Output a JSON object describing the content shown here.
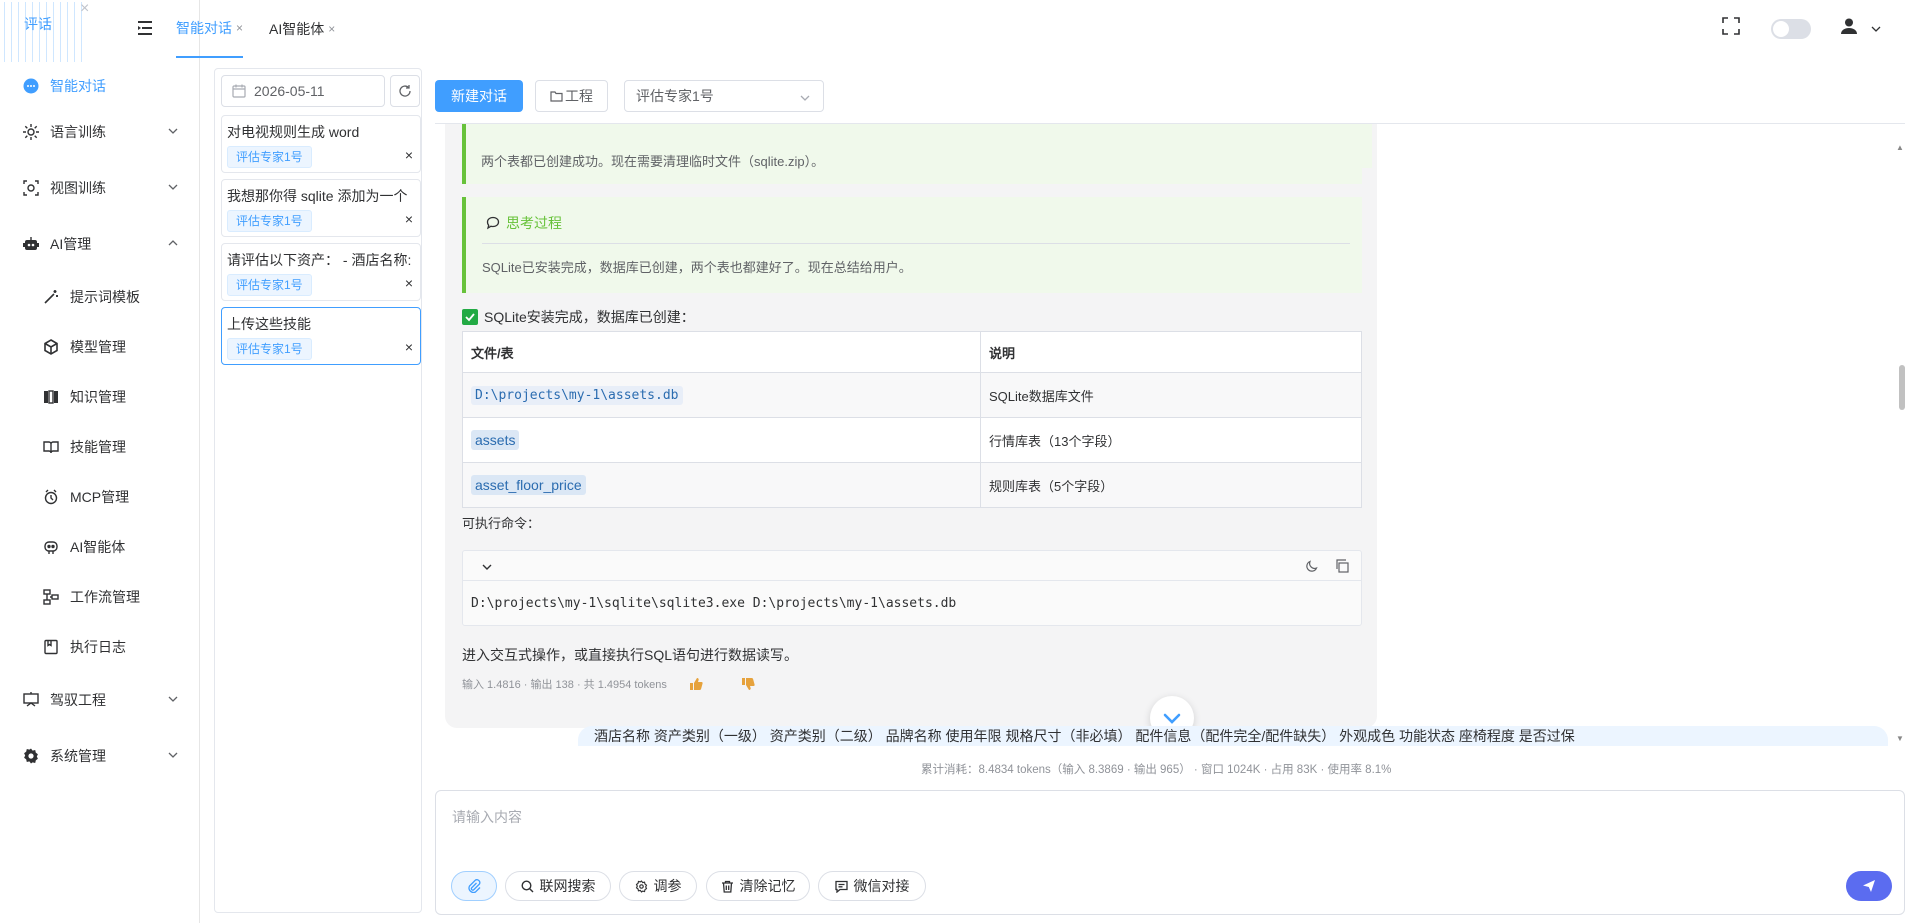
{
  "app": {
    "logo_text": "评话",
    "logo_close": "×"
  },
  "topbar": {
    "tabs": [
      {
        "label": "智能对话",
        "close": "×",
        "active": true
      },
      {
        "label": "AI智能体",
        "close": "×",
        "active": false
      }
    ]
  },
  "sidebar": {
    "items": [
      {
        "label": "智能对话",
        "icon": "chat-bubble-icon",
        "active": true
      },
      {
        "label": "语言训练",
        "icon": "language-icon"
      },
      {
        "label": "视图训练",
        "icon": "view-icon"
      },
      {
        "label": "AI管理",
        "icon": "robot-icon",
        "expanded": true
      },
      {
        "label": "驾驭工程",
        "icon": "project-icon"
      },
      {
        "label": "系统管理",
        "icon": "gear-icon"
      }
    ],
    "ai_sub": [
      {
        "label": "提示词模板",
        "icon": "magic-wand-icon"
      },
      {
        "label": "模型管理",
        "icon": "cube-icon"
      },
      {
        "label": "知识管理",
        "icon": "book-icon"
      },
      {
        "label": "技能管理",
        "icon": "skill-book-icon"
      },
      {
        "label": "MCP管理",
        "icon": "mcp-icon"
      },
      {
        "label": "AI智能体",
        "icon": "agent-icon"
      },
      {
        "label": "工作流管理",
        "icon": "workflow-icon"
      },
      {
        "label": "执行日志",
        "icon": "log-icon"
      }
    ]
  },
  "sessions": {
    "date": "2026-05-11",
    "list": [
      {
        "title": "对电视规则生成 word",
        "tag": "评估专家1号"
      },
      {
        "title": "我想那你得 sqlite 添加为一个",
        "tag": "评估专家1号"
      },
      {
        "title": "请评估以下资产： - 酒店名称:",
        "tag": "评估专家1号"
      },
      {
        "title": "上传这些技能",
        "tag": "评估专家1号",
        "active": true
      }
    ],
    "close_glyph": "×"
  },
  "toolbar": {
    "new_chat": "新建对话",
    "project": "工程",
    "agent_select": "评估专家1号"
  },
  "chat": {
    "notice_top": "两个表都已创建成功。现在需要清理临时文件（sqlite.zip）。",
    "think_title": "思考过程",
    "think_body": "SQLite已安装完成，数据库已创建，两个表也都建好了。现在总结给用户。",
    "done_text": "SQLite安装完成，数据库已创建：",
    "table": {
      "headers": [
        "文件/表",
        "说明"
      ],
      "rows": [
        {
          "name": "D:\\projects\\my-1\\assets.db",
          "desc": "SQLite数据库文件"
        },
        {
          "name": "assets",
          "desc": "行情库表（13个字段）"
        },
        {
          "name": "asset_floor_price",
          "desc": "规则库表（5个字段）"
        }
      ]
    },
    "cmd_label": "可执行命令：",
    "code": "D:\\projects\\my-1\\sqlite\\sqlite3.exe D:\\projects\\my-1\\assets.db",
    "after_text": "进入交互式操作，或直接执行SQL语句进行数据读写。",
    "meta": "输入 1.4816 · 输出 138 · 共 1.4954 tokens",
    "user_message": "酒店名称 资产类别（一级） 资产类别（二级） 品牌名称 使用年限 规格尺寸（非必填） 配件信息（配件完全/配件缺失） 外观成色 功能状态 座椅程度 是否过保 "
  },
  "usage": {
    "text": "累计消耗：8.4834 tokens（输入 8.3869 · 输出 965） · 窗口 1024K · 占用 83K · 使用率 8.1%"
  },
  "input": {
    "placeholder": "请输入内容",
    "buttons": {
      "web_search": "联网搜索",
      "tune": "调参",
      "clear_memory": "清除记忆",
      "wechat": "微信对接"
    }
  },
  "colors": {
    "primary": "#409eff",
    "success": "#67c23a",
    "send": "#5b6cf0"
  }
}
